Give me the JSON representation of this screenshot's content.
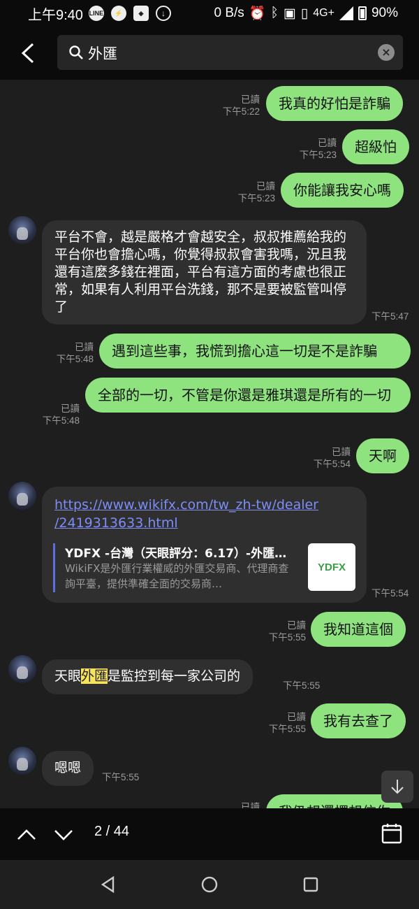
{
  "status_bar": {
    "time": "上午9:40",
    "net_speed": "0 B/s",
    "network": "4G+",
    "battery": "90%",
    "icons": [
      "line-icon",
      "messenger-icon",
      "app-icon",
      "download-icon",
      "alarm-icon",
      "bluetooth-icon",
      "nfc-icon",
      "vibrate-icon",
      "volte-icon",
      "signal-icon",
      "battery-icon"
    ]
  },
  "header": {
    "search_query": "外匯"
  },
  "messages": [
    {
      "dir": "out",
      "text": "我真的好怕是詐騙",
      "read": "已讀",
      "time": "下午5:22"
    },
    {
      "dir": "out",
      "text": "超級怕",
      "read": "已讀",
      "time": "下午5:23"
    },
    {
      "dir": "out",
      "text": "你能讓我安心嗎",
      "read": "已讀",
      "time": "下午5:23"
    },
    {
      "dir": "in",
      "text": "平台不會，越是嚴格才會越安全，叔叔推薦給我的平台你也會擔心嗎，你覺得叔叔會害我嗎，況且我還有這麼多錢在裡面，平台有這方面的考慮也很正常，如果有人利用平台洗錢，那不是要被監管叫停了",
      "time": "下午5:47"
    },
    {
      "dir": "out",
      "text": "遇到這些事，我慌到擔心這一切是不是詐騙",
      "read": "已讀",
      "time": "下午5:48"
    },
    {
      "dir": "out",
      "text": "全部的一切，不管是你還是雅琪還是所有的一切",
      "read": "已讀",
      "time": "下午5:48"
    },
    {
      "dir": "out",
      "text": "天啊",
      "read": "已讀",
      "time": "下午5:54"
    },
    {
      "dir": "in",
      "link": "https://www.wikifx.com/tw_zh-tw/dealer/2419313633.html",
      "link_line1": "https://www.wikifx.com/tw_zh-tw/dealer",
      "link_line2": "/2419313633.html",
      "preview_title": "YDFX -台灣（天眼評分：6.17）-外匯…",
      "preview_desc": "WikiFX是外匯行業權威的外匯交易商、代理商查詢平臺，提供準確全面的交易商…",
      "preview_thumb": "YDFX",
      "time": "下午5:54"
    },
    {
      "dir": "out",
      "text": "我知道這個",
      "read": "已讀",
      "time": "下午5:55"
    },
    {
      "dir": "in",
      "text_before": "天眼",
      "text_highlight": "外匯",
      "text_after": "是監控到每一家公司的",
      "time": "下午5:55"
    },
    {
      "dir": "out",
      "text": "我有去查了",
      "read": "已讀",
      "time": "下午5:55"
    },
    {
      "dir": "in",
      "text": "嗯嗯",
      "time": "下午5:55"
    },
    {
      "dir": "out",
      "text": "我仍想還擇想信你",
      "read": "已讀",
      "time": ""
    }
  ],
  "search_nav": {
    "counter": "2 / 44"
  }
}
